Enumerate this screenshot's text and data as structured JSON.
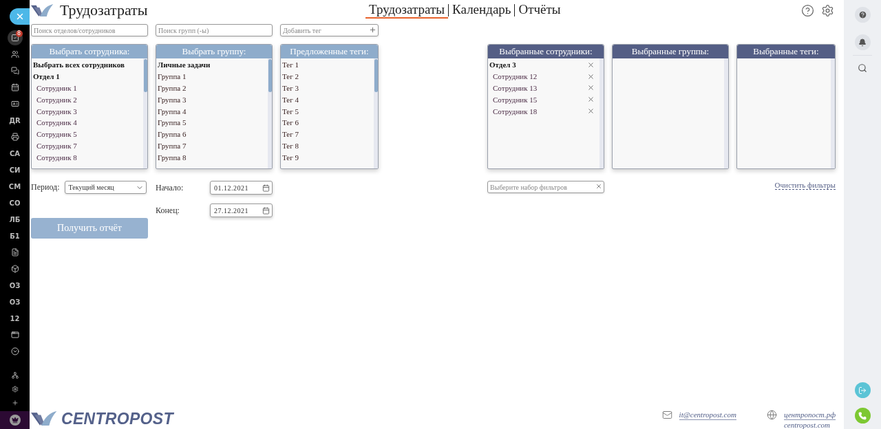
{
  "sidebar": {
    "items": [
      {
        "kind": "icon",
        "badge": "8",
        "selected": true
      },
      {
        "kind": "icon",
        "selected": false
      },
      {
        "kind": "icon",
        "selected": false
      },
      {
        "kind": "icon",
        "selected": false
      },
      {
        "kind": "icon",
        "selected": false
      },
      {
        "kind": "text",
        "label": "ДR",
        "selected": false
      },
      {
        "kind": "icon",
        "selected": false
      },
      {
        "kind": "text",
        "label": "СА",
        "selected": false
      },
      {
        "kind": "text",
        "label": "СИ",
        "selected": false
      },
      {
        "kind": "text",
        "label": "СМ",
        "selected": false
      },
      {
        "kind": "text",
        "label": "СО",
        "selected": false
      },
      {
        "kind": "text",
        "label": "ЛБ",
        "selected": false
      },
      {
        "kind": "text",
        "label": "Б1",
        "selected": false
      },
      {
        "kind": "icon",
        "selected": false
      },
      {
        "kind": "icon",
        "selected": false
      },
      {
        "kind": "text",
        "label": "ОЗ",
        "selected": false
      },
      {
        "kind": "text",
        "label": "ОЗ",
        "selected": false
      },
      {
        "kind": "text",
        "label": "12",
        "selected": false
      },
      {
        "kind": "icon",
        "selected": false
      },
      {
        "kind": "icon",
        "selected": false
      }
    ],
    "bottom": [
      {
        "kind": "icon"
      },
      {
        "kind": "icon"
      },
      {
        "kind": "icon"
      }
    ]
  },
  "header": {
    "title": "Трудозатраты",
    "tabs": [
      {
        "label": "Трудозатраты",
        "selected": true
      },
      {
        "label": "Календарь",
        "selected": false
      },
      {
        "label": "Отчёты",
        "selected": false
      }
    ]
  },
  "searches": [
    {
      "placeholder": "Поиск отделов/сотрудников"
    },
    {
      "placeholder": "Поиск групп (-ы)"
    },
    {
      "placeholder": "Добавить тег",
      "add": true
    }
  ],
  "pickers": [
    {
      "title": "Выбрать сотрудника:",
      "items": [
        {
          "kind": "all",
          "label": "Выбрать всех сотрудников"
        },
        {
          "kind": "group",
          "label": "Отдел 1"
        },
        {
          "kind": "member",
          "label": "Сотрудник 1"
        },
        {
          "kind": "member",
          "label": "Сотрудник 2"
        },
        {
          "kind": "member",
          "label": "Сотрудник 3"
        },
        {
          "kind": "member",
          "label": "Сотрудник 4"
        },
        {
          "kind": "member",
          "label": "Сотрудник 5"
        },
        {
          "kind": "member",
          "label": "Сотрудник 7"
        },
        {
          "kind": "member",
          "label": "Сотрудник 8"
        }
      ]
    },
    {
      "title": "Выбрать группу:",
      "items": [
        {
          "kind": "all",
          "label": "Личные задачи"
        },
        {
          "kind": "plain",
          "label": "Группа 1"
        },
        {
          "kind": "plain",
          "label": "Группа 2"
        },
        {
          "kind": "plain",
          "label": "Группа 3"
        },
        {
          "kind": "plain",
          "label": "Группа 4"
        },
        {
          "kind": "plain",
          "label": "Группа 5"
        },
        {
          "kind": "plain",
          "label": "Группа 6"
        },
        {
          "kind": "plain",
          "label": "Группа 7"
        },
        {
          "kind": "plain",
          "label": "Группа 8"
        }
      ]
    },
    {
      "title": "Предложенные теги:",
      "items": [
        {
          "kind": "plain",
          "label": "Тег 1"
        },
        {
          "kind": "plain",
          "label": "Тег 2"
        },
        {
          "kind": "plain",
          "label": "Тег 3"
        },
        {
          "kind": "plain",
          "label": "Тег 4"
        },
        {
          "kind": "plain",
          "label": "Тег 5"
        },
        {
          "kind": "plain",
          "label": "Тег 6"
        },
        {
          "kind": "plain",
          "label": "Тег 7"
        },
        {
          "kind": "plain",
          "label": "Тег 8"
        },
        {
          "kind": "plain",
          "label": "Тег 9"
        }
      ]
    }
  ],
  "selected_panels": [
    {
      "title": "Выбранные сотрудники:",
      "items": [
        {
          "kind": "group",
          "label": "Отдел 3"
        },
        {
          "kind": "member",
          "label": "Сотрудник 12"
        },
        {
          "kind": "member",
          "label": "Сотрудник 13"
        },
        {
          "kind": "member",
          "label": "Сотрудник 15"
        },
        {
          "kind": "member",
          "label": "Сотрудник 18"
        }
      ]
    },
    {
      "title": "Выбранные группы:"
    },
    {
      "title": "Выбранные теги:"
    }
  ],
  "period": {
    "label": "Период:",
    "value": "Текущий месяц"
  },
  "start": {
    "label": "Начало:",
    "value": "01.12.2021"
  },
  "end": {
    "label": "Конец:",
    "value": "27.12.2021"
  },
  "filter_set": {
    "placeholder": "Выберите набор фильтров"
  },
  "clear_link": "Очистить фильтры",
  "submit": {
    "label": "Получить отчёт",
    "disabled": true
  },
  "footer": {
    "brand": "CENTROPOST",
    "email": "it@centropost.com",
    "sites": [
      "центропост.рф",
      "centropost.com"
    ]
  }
}
